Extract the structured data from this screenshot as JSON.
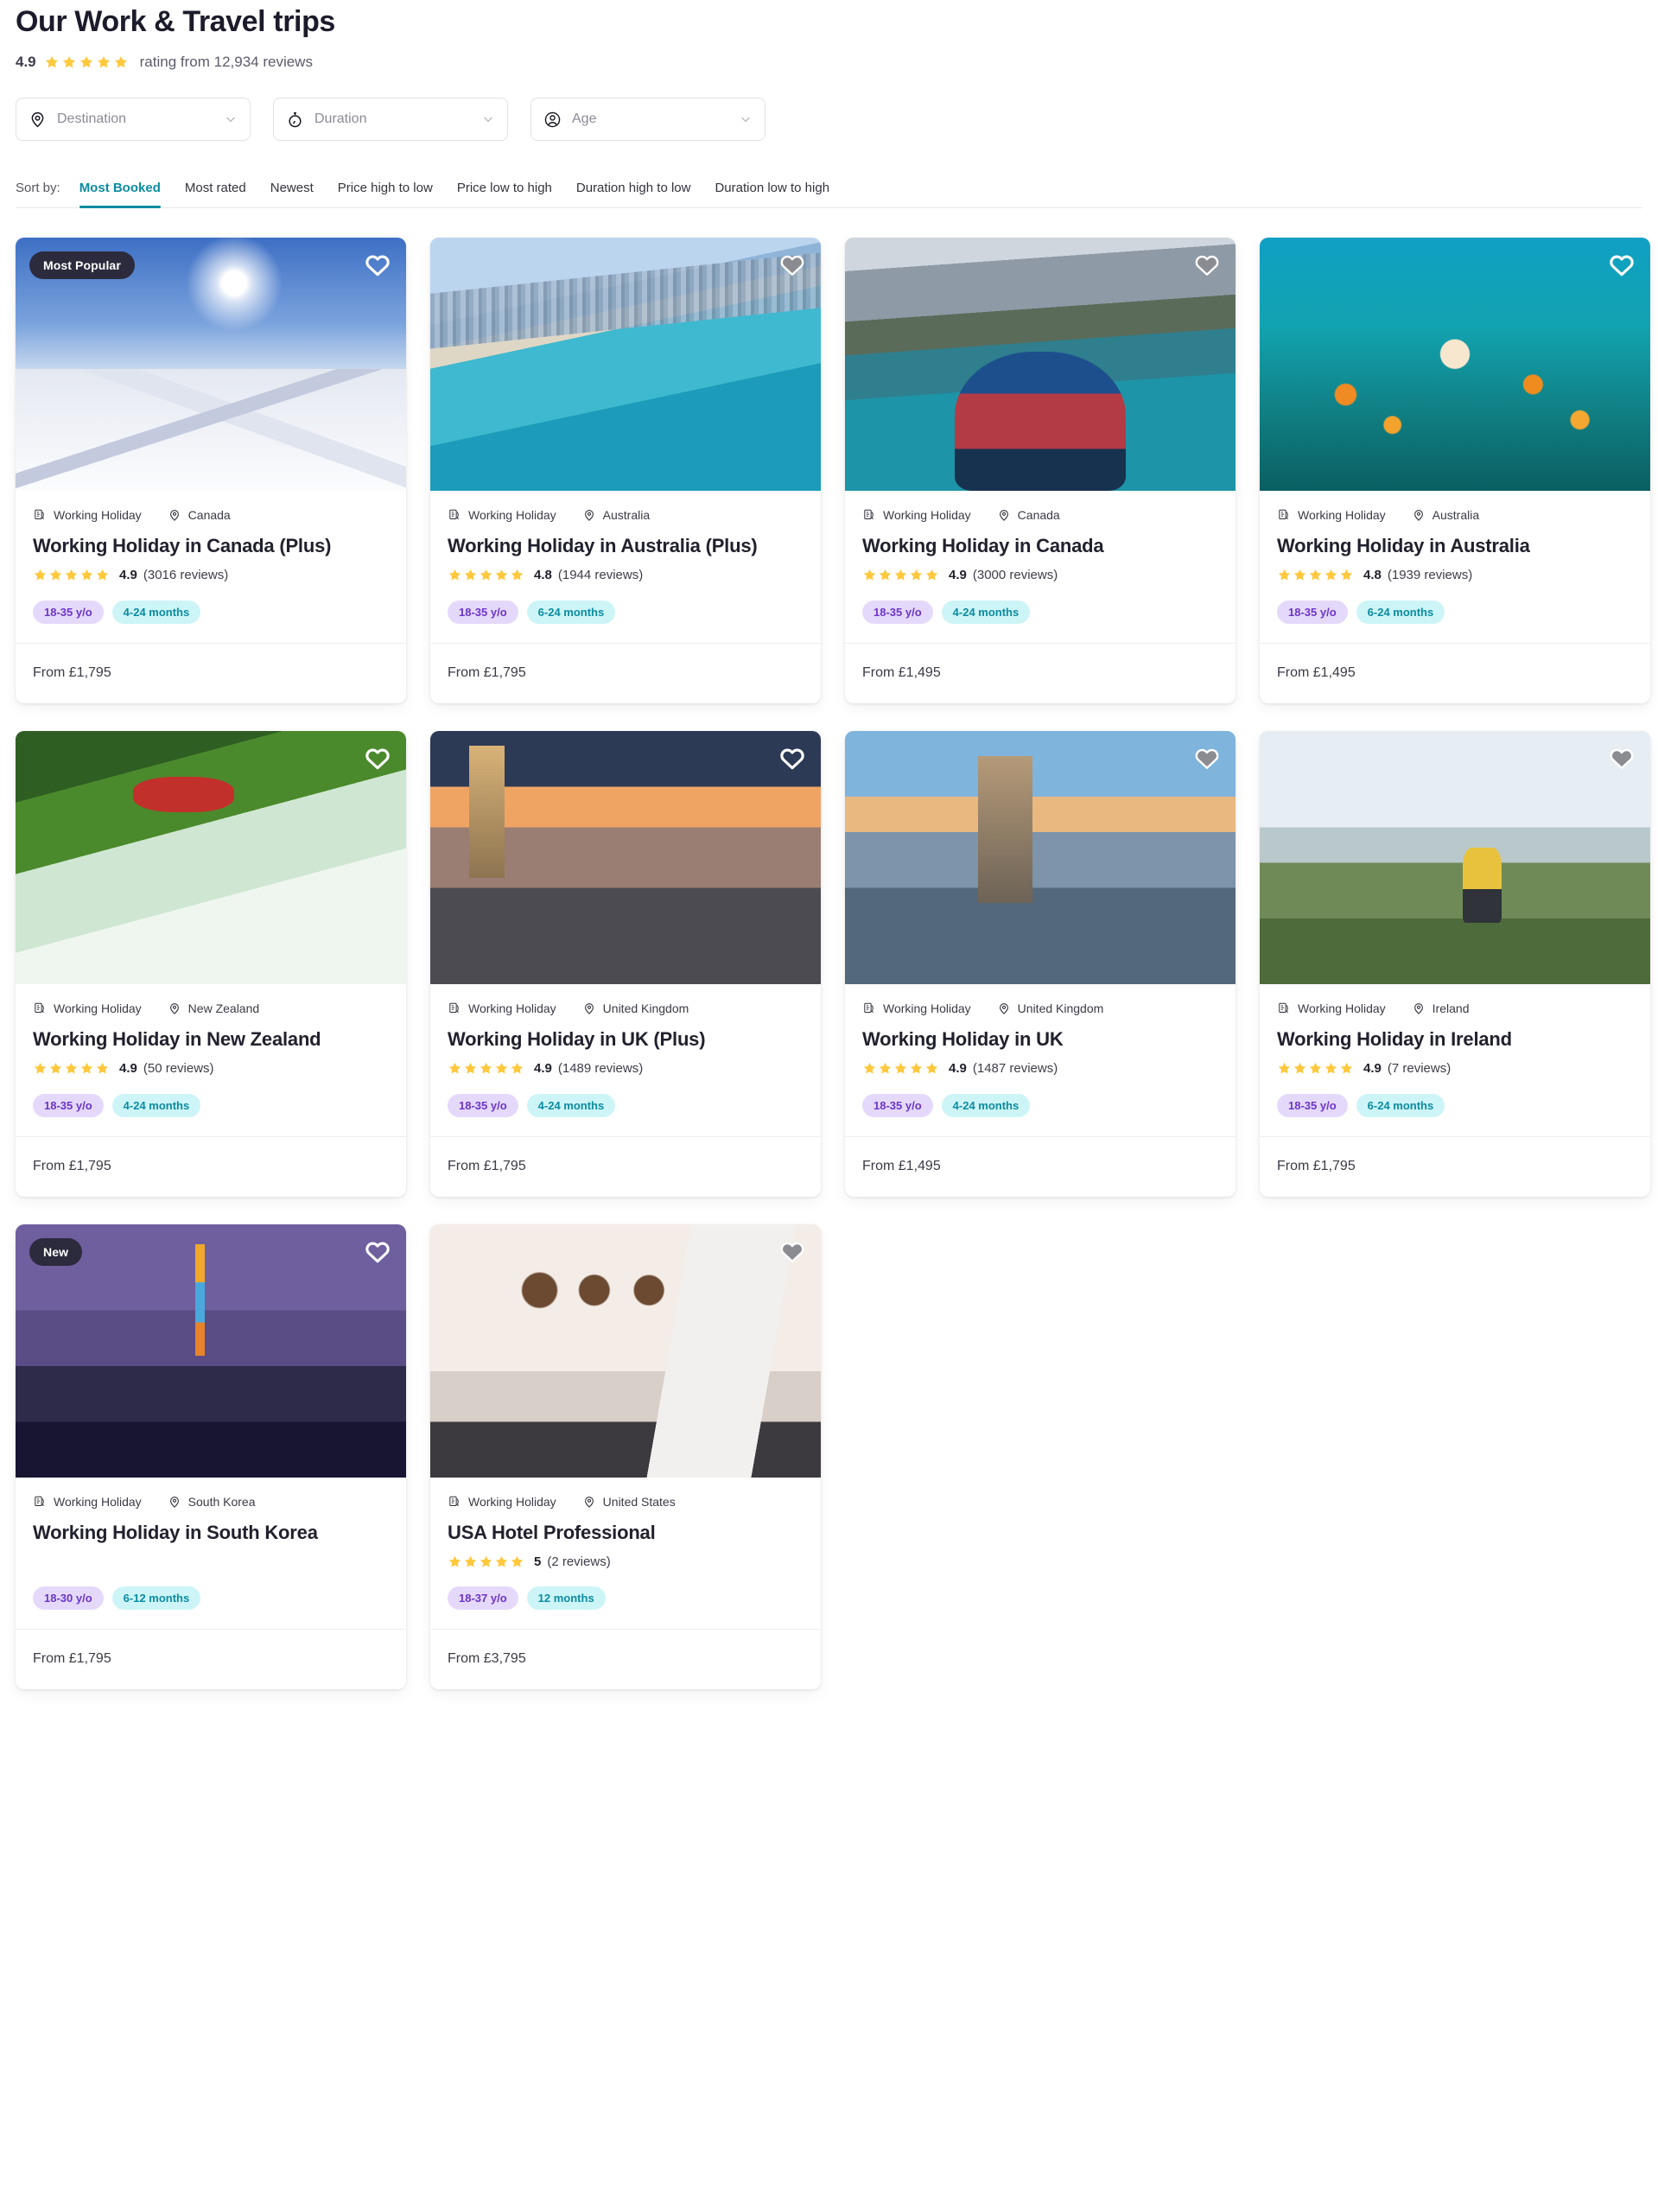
{
  "header": {
    "title": "Our Work & Travel trips",
    "rating_score": "4.9",
    "rating_caption": "rating from 12,934 reviews",
    "star_count": 5,
    "star_color": "#ffc83d"
  },
  "filters": [
    {
      "label": "Destination",
      "icon": "location-pin-icon"
    },
    {
      "label": "Duration",
      "icon": "stopwatch-icon"
    },
    {
      "label": "Age",
      "icon": "person-circle-icon"
    }
  ],
  "sort": {
    "label": "Sort by:",
    "active": "Most Booked",
    "accent_color": "#0b8ba1",
    "options": [
      "Most Booked",
      "Most rated",
      "Newest",
      "Price high to low",
      "Price low to high",
      "Duration high to low",
      "Duration low to high"
    ]
  },
  "tag_colors": {
    "age_bg": "#e5d9fb",
    "age_fg": "#6b35c9",
    "duration_bg": "#cdf5f7",
    "duration_fg": "#0b8ba1"
  },
  "cards": [
    {
      "badge": "Most Popular",
      "favourite": "outline",
      "photo": "ph-ski",
      "category": "Working Holiday",
      "location": "Canada",
      "title": "Working Holiday in Canada (Plus)",
      "rating": "4.9",
      "reviews": "(3016 reviews)",
      "stars": 5,
      "age_tag": "18-35 y/o",
      "duration_tag": "4-24 months",
      "price": "From £1,795"
    },
    {
      "badge": null,
      "favourite": "filled",
      "photo": "ph-gold",
      "category": "Working Holiday",
      "location": "Australia",
      "title": "Working Holiday in Australia (Plus)",
      "rating": "4.8",
      "reviews": "(1944 reviews)",
      "stars": 5,
      "age_tag": "18-35 y/o",
      "duration_tag": "6-24 months",
      "price": "From £1,795"
    },
    {
      "badge": null,
      "favourite": "filled",
      "photo": "ph-lake",
      "category": "Working Holiday",
      "location": "Canada",
      "title": "Working Holiday in Canada",
      "rating": "4.9",
      "reviews": "(3000 reviews)",
      "stars": 5,
      "age_tag": "18-35 y/o",
      "duration_tag": "4-24 months",
      "price": "From £1,495"
    },
    {
      "badge": null,
      "favourite": "outline",
      "photo": "ph-reef",
      "category": "Working Holiday",
      "location": "Australia",
      "title": "Working Holiday in Australia",
      "rating": "4.8",
      "reviews": "(1939 reviews)",
      "stars": 5,
      "age_tag": "18-35 y/o",
      "duration_tag": "6-24 months",
      "price": "From £1,495"
    },
    {
      "badge": null,
      "favourite": "outline",
      "photo": "ph-raft",
      "category": "Working Holiday",
      "location": "New Zealand",
      "title": "Working Holiday in New Zealand",
      "rating": "4.9",
      "reviews": "(50 reviews)",
      "stars": 5,
      "age_tag": "18-35 y/o",
      "duration_tag": "4-24 months",
      "price": "From £1,795"
    },
    {
      "badge": null,
      "favourite": "outline",
      "photo": "ph-london",
      "category": "Working Holiday",
      "location": "United Kingdom",
      "title": "Working Holiday in UK (Plus)",
      "rating": "4.9",
      "reviews": "(1489 reviews)",
      "stars": 5,
      "age_tag": "18-35 y/o",
      "duration_tag": "4-24 months",
      "price": "From £1,795"
    },
    {
      "badge": null,
      "favourite": "filled",
      "photo": "ph-tower",
      "category": "Working Holiday",
      "location": "United Kingdom",
      "title": "Working Holiday in UK",
      "rating": "4.9",
      "reviews": "(1487 reviews)",
      "stars": 5,
      "age_tag": "18-35 y/o",
      "duration_tag": "4-24 months",
      "price": "From £1,495"
    },
    {
      "badge": null,
      "favourite": "filled",
      "photo": "ph-cliffs",
      "category": "Working Holiday",
      "location": "Ireland",
      "title": "Working Holiday in Ireland",
      "rating": "4.9",
      "reviews": "(7 reviews)",
      "stars": 5,
      "age_tag": "18-35 y/o",
      "duration_tag": "6-24 months",
      "price": "From £1,795"
    },
    {
      "badge": "New",
      "favourite": "outline",
      "photo": "ph-seoul",
      "category": "Working Holiday",
      "location": "South Korea",
      "title": "Working Holiday in South Korea",
      "rating": null,
      "reviews": null,
      "stars": 0,
      "age_tag": "18-30 y/o",
      "duration_tag": "6-12 months",
      "price": "From £1,795"
    },
    {
      "badge": null,
      "favourite": "filled",
      "photo": "ph-hotel",
      "category": "Working Holiday",
      "location": "United States",
      "title": "USA Hotel Professional",
      "rating": "5",
      "reviews": "(2 reviews)",
      "stars": 5,
      "age_tag": "18-37 y/o",
      "duration_tag": "12 months",
      "price": "From £3,795"
    }
  ]
}
